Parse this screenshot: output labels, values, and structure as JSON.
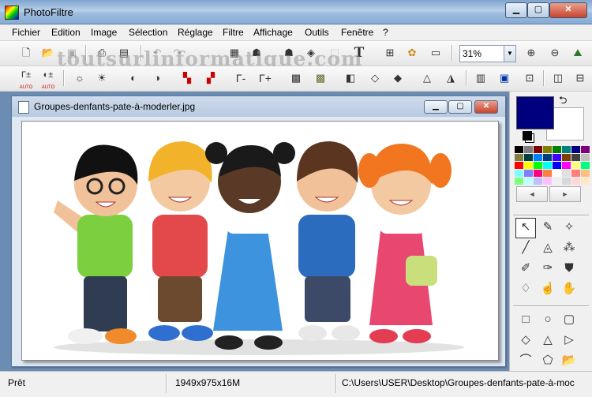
{
  "app": {
    "title": "PhotoFiltre"
  },
  "window_buttons": {
    "minimize": "▁",
    "maximize": "▢",
    "close": "✕"
  },
  "menu": [
    "Fichier",
    "Edition",
    "Image",
    "Sélection",
    "Réglage",
    "Filtre",
    "Affichage",
    "Outils",
    "Fenêtre",
    "?"
  ],
  "toolbar": {
    "zoom": "31%",
    "watermark": "toutsurlinformatique.com",
    "text_tool_label": "T"
  },
  "toolbar2": {
    "gamma_auto": "AUTO",
    "gamma_minus": "Γ-",
    "gamma_plus": "Γ+"
  },
  "document": {
    "title": "Groupes-denfants-pate-à-moderler.jpg",
    "image_alt": "children-group-illustration"
  },
  "colors": {
    "foreground": "#00007f",
    "background": "#ffffff",
    "palette": [
      "#000000",
      "#7f7f7f",
      "#7f0000",
      "#7f7f00",
      "#007f00",
      "#007f7f",
      "#00007f",
      "#7f007f",
      "#7f7f3f",
      "#003f3f",
      "#007fff",
      "#003f7f",
      "#3f00ff",
      "#7f3f00",
      "#404040",
      "#c0c0c0",
      "#ff0000",
      "#ffff00",
      "#00ff00",
      "#00ffff",
      "#0000ff",
      "#ff00ff",
      "#ffff7f",
      "#00ff7f",
      "#7fffff",
      "#7f7fff",
      "#ff007f",
      "#ff7f3f",
      "#ffffff",
      "#e0e0e0",
      "#ff7f7f",
      "#ffbf7f",
      "#7fff7f",
      "#bfffff",
      "#bfbfff",
      "#ffbfff",
      "#f0f0f0",
      "#d8d8d8",
      "#ffd8d8",
      "#ffe8c8"
    ],
    "palette_prev": "◄",
    "palette_next": "►"
  },
  "status": {
    "state": "Prêt",
    "dimensions": "1949x975x16M",
    "path": "C:\\Users\\USER\\Desktop\\Groupes-denfants-pate-à-moc"
  }
}
